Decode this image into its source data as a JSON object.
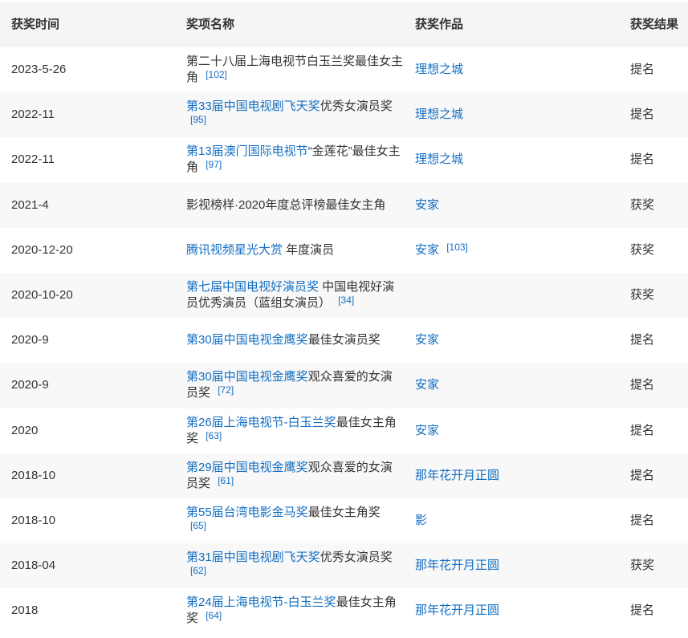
{
  "colors": {
    "link": "#136ec2",
    "text": "#333333",
    "header_background": "#f5f5f5",
    "stripe_background": "#f8f8f8"
  },
  "awards_table": {
    "headers": {
      "date": "获奖时间",
      "award": "奖项名称",
      "work": "获奖作品",
      "result": "获奖结果"
    },
    "rows": [
      {
        "date": "2023-5-26",
        "award_text": "第二十八届上海电视节白玉兰奖最佳女主角",
        "ref": "[102]",
        "work": "理想之城",
        "result": "提名"
      },
      {
        "date": "2022-11",
        "award_link": "第33届中国电视剧飞天奖",
        "award_text": "优秀女演员奖",
        "ref": "[95]",
        "work": "理想之城",
        "result": "提名"
      },
      {
        "date": "2022-11",
        "award_link": "第13届澳门国际电视节",
        "award_text": "“金莲花”最佳女主角",
        "ref": "[97]",
        "work": "理想之城",
        "result": "提名"
      },
      {
        "date": "2021-4",
        "award_text": "影视榜样·2020年度总评榜最佳女主角",
        "work": "安家",
        "result": "获奖"
      },
      {
        "date": "2020-12-20",
        "award_link": "腾讯视频星光大赏",
        "award_text": " 年度演员",
        "work": "安家",
        "work_ref": "[103]",
        "result": "获奖"
      },
      {
        "date": "2020-10-20",
        "award_link": "第七届中国电视好演员奖",
        "award_text": " 中国电视好演员优秀演员（蓝组女演员）",
        "ref": "[34]",
        "result": "获奖"
      },
      {
        "date": "2020-9",
        "award_link": "第30届中国电视金鹰奖",
        "award_text": "最佳女演员奖",
        "work": "安家",
        "result": "提名"
      },
      {
        "date": "2020-9",
        "award_link": "第30届中国电视金鹰奖",
        "award_text": "观众喜爱的女演员奖",
        "ref": "[72]",
        "work": "安家",
        "result": "提名"
      },
      {
        "date": "2020",
        "award_link": "第26届上海电视节-白玉兰奖",
        "award_text": "最佳女主角奖",
        "ref": "[63]",
        "work": "安家",
        "result": "提名"
      },
      {
        "date": "2018-10",
        "award_link": "第29届中国电视金鹰奖",
        "award_text": "观众喜爱的女演员奖",
        "ref": "[61]",
        "work": "那年花开月正圆",
        "result": "提名"
      },
      {
        "date": "2018-10",
        "award_link": "第55届台湾电影金马奖",
        "award_text": "最佳女主角奖",
        "ref": "[65]",
        "work": "影",
        "result": "提名"
      },
      {
        "date": "2018-04",
        "award_link": "第31届中国电视剧飞天奖",
        "award_text": "优秀女演员奖",
        "ref": "[62]",
        "work": "那年花开月正圆",
        "result": "获奖"
      },
      {
        "date": "2018",
        "award_link": "第24届上海电视节-白玉兰奖",
        "award_text": "最佳女主角奖",
        "ref": "[64]",
        "work": "那年花开月正圆",
        "result": "提名"
      }
    ]
  }
}
